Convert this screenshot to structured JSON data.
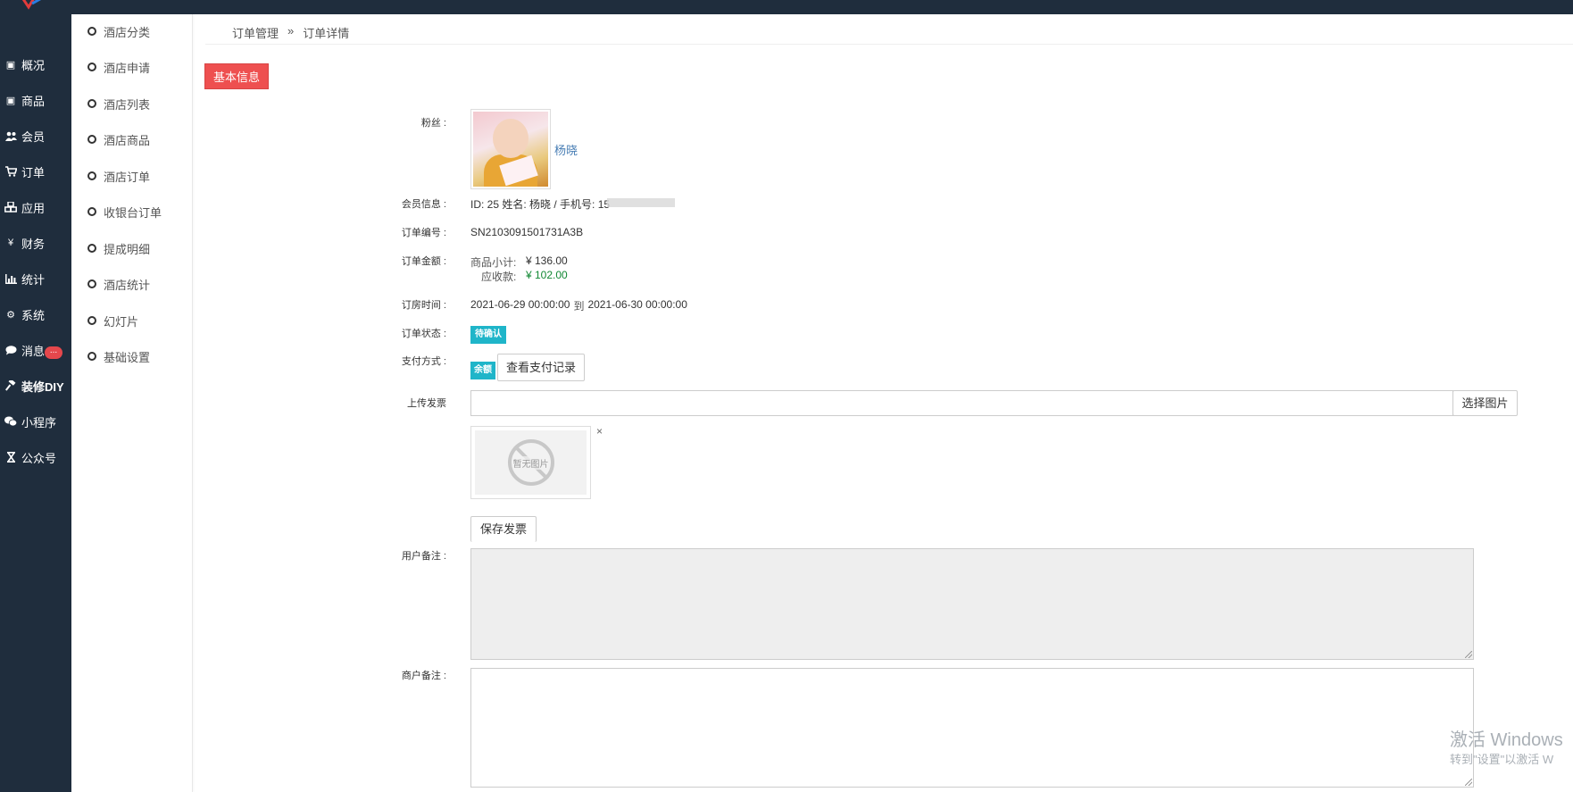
{
  "colors": {
    "sidebar_bg": "#1f2d3d",
    "tab_active": "#ee5050",
    "badge": "#1fb5c9",
    "link": "#4a7fb5",
    "amount_green": "#118833"
  },
  "sidebar": {
    "items": [
      {
        "label": "概况",
        "icon": "archive-icon"
      },
      {
        "label": "商品",
        "icon": "archive-icon"
      },
      {
        "label": "会员",
        "icon": "users-icon"
      },
      {
        "label": "订单",
        "icon": "cart-icon"
      },
      {
        "label": "应用",
        "icon": "cubes-icon"
      },
      {
        "label": "财务",
        "icon": "yen-icon"
      },
      {
        "label": "统计",
        "icon": "bar-chart-icon"
      },
      {
        "label": "系统",
        "icon": "gears-icon"
      },
      {
        "label": "消息",
        "icon": "comment-icon"
      },
      {
        "label": "装修DIY",
        "icon": "gavel-icon"
      },
      {
        "label": "小程序",
        "icon": "wechat-icon"
      },
      {
        "label": "公众号",
        "icon": "hourglass-icon"
      }
    ],
    "message_badge": "..."
  },
  "subnav": {
    "items": [
      "酒店分类",
      "酒店申请",
      "酒店列表",
      "酒店商品",
      "酒店订单",
      "收银台订单",
      "提成明细",
      "酒店统计",
      "幻灯片",
      "基础设置"
    ]
  },
  "breadcrumb": {
    "parent": "订单管理",
    "separator": "»",
    "current": "订单详情"
  },
  "tab": {
    "label": "基本信息"
  },
  "order": {
    "fans_label": "粉丝 :",
    "fans_name": "杨晓",
    "member_label": "会员信息 :",
    "member_value": "ID: 25 姓名: 杨晓 / 手机号: 15",
    "order_no_label": "订单编号 :",
    "order_no": "SN2103091501731A3B",
    "amount_label": "订单金额 :",
    "subtotal_label": "商品小计:",
    "subtotal_value": "¥ 136.00",
    "receivable_label": "应收款:",
    "receivable_value": "¥ 102.00",
    "checkin_label": "订房时间 :",
    "checkin_start": "2021-06-29 00:00:00",
    "checkin_to": "到",
    "checkin_end": "2021-06-30 00:00:00",
    "status_label": "订单状态 :",
    "status_value": "待确认",
    "pay_label": "支付方式 :",
    "pay_value": "余额",
    "pay_record_button": "查看支付记录",
    "invoice_label": "上传发票",
    "invoice_value": "",
    "choose_image_button": "选择图片",
    "no_image_text": "暂无图片",
    "remove_icon": "×",
    "save_invoice_button": "保存发票",
    "user_note_label": "用户备注 :",
    "user_note": "",
    "merchant_note_label": "商户备注 :",
    "merchant_note": ""
  },
  "watermark": {
    "line1": "激活 Windows",
    "line2": "转到\"设置\"以激活 W"
  }
}
